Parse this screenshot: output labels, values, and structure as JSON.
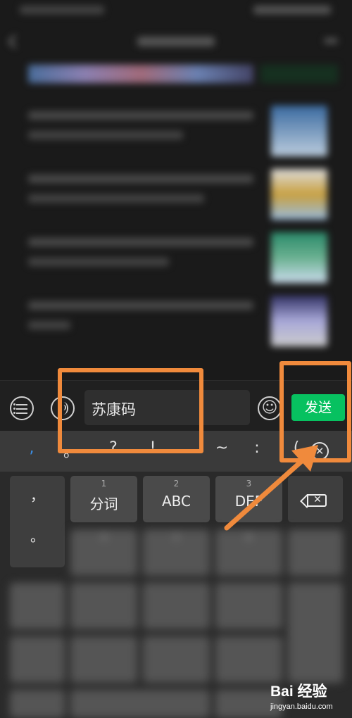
{
  "input_bar": {
    "text_value": "苏康码",
    "send_label": "发送",
    "list_icon": "list-icon",
    "voice_icon": "voice-icon",
    "emoji_icon": "emoji-icon",
    "emoji_glyph": "☺"
  },
  "keyboard": {
    "punctuation": [
      ",",
      "。",
      "?",
      "!",
      "...",
      "~",
      ":",
      "("
    ],
    "clear_glyph": "✕",
    "left_key": {
      "top": "，",
      "bottom": "。"
    },
    "keys": [
      {
        "num": "1",
        "label": "分词"
      },
      {
        "num": "2",
        "label": "ABC"
      },
      {
        "num": "3",
        "label": "DEF"
      }
    ],
    "blurred_nums": [
      "4",
      "5",
      "6"
    ]
  },
  "watermark": {
    "brand": "Bai 经验",
    "url": "jingyan.baidu.com"
  },
  "colors": {
    "send_green": "#07c160",
    "highlight_orange": "#f08a3c",
    "accent_blue": "#3a8ee6"
  }
}
